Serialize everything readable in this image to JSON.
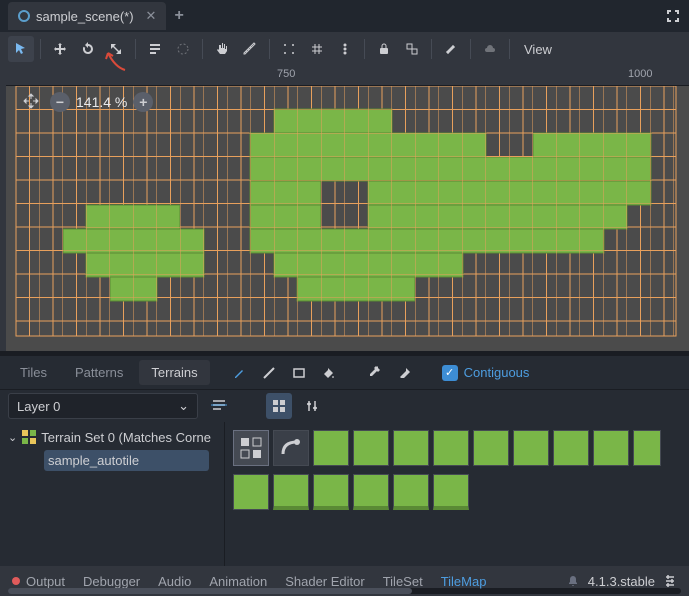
{
  "tab": {
    "title": "sample_scene(*)"
  },
  "toolbar": {
    "view": "View"
  },
  "viewport": {
    "zoom": "141.4 %",
    "ruler_750": "750",
    "ruler_1000": "1000"
  },
  "panel": {
    "tabs": {
      "tiles": "Tiles",
      "patterns": "Patterns",
      "terrains": "Terrains"
    },
    "contiguous": "Contiguous",
    "layer": "Layer 0",
    "terrain_set": "Terrain Set 0 (Matches Corne",
    "autotile": "sample_autotile"
  },
  "status": {
    "output": "Output",
    "debugger": "Debugger",
    "audio": "Audio",
    "animation": "Animation",
    "shader": "Shader Editor",
    "tileset": "TileSet",
    "tilemap": "TileMap",
    "version": "4.1.3.stable"
  }
}
